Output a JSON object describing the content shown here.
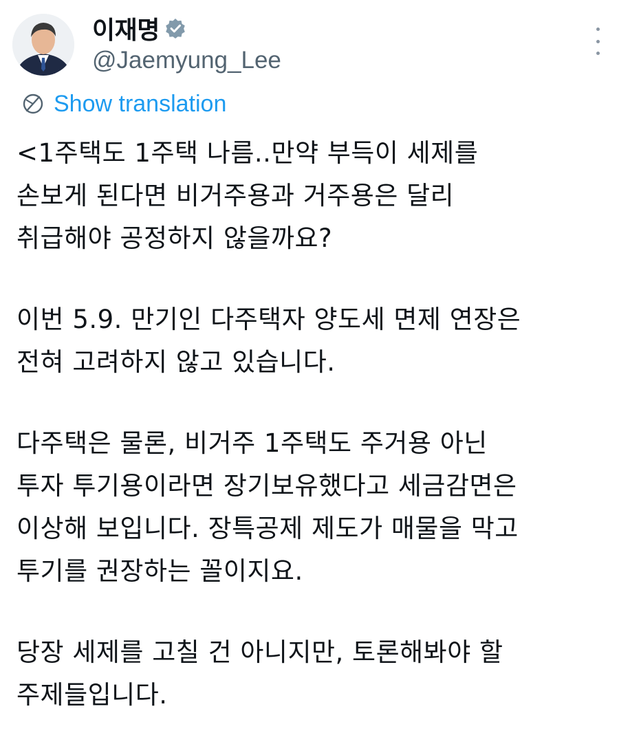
{
  "author": {
    "display_name": "이재명",
    "handle": "@Jaemyung_Lee",
    "verified_icon": "verified-badge-icon",
    "avatar_icon": "profile-photo"
  },
  "actions": {
    "more_icon": "more-options-icon",
    "translate_icon": "globe-icon",
    "translate_label": "Show translation"
  },
  "tweet": {
    "paragraphs": [
      [
        "<1주택도 1주택 나름..만약 부득이 세제를",
        "손보게 된다면 비거주용과 거주용은 달리",
        "취급해야 공정하지 않을까요?"
      ],
      [
        "이번 5.9. 만기인 다주택자 양도세 면제 연장은",
        "전혀 고려하지 않고 있습니다."
      ],
      [
        "다주택은 물론, 비거주 1주택도 주거용 아닌",
        "투자 투기용이라면 장기보유했다고 세금감면은",
        "이상해 보입니다. 장특공제 제도가 매물을 막고",
        "투기를 권장하는 꼴이지요."
      ],
      [
        "당장 세제를 고칠 건 아니지만, 토론해봐야 할",
        "주제들입니다."
      ]
    ]
  },
  "colors": {
    "text": "#0f1419",
    "secondary": "#536471",
    "link": "#1d9bf0",
    "verified": "#829aab"
  }
}
